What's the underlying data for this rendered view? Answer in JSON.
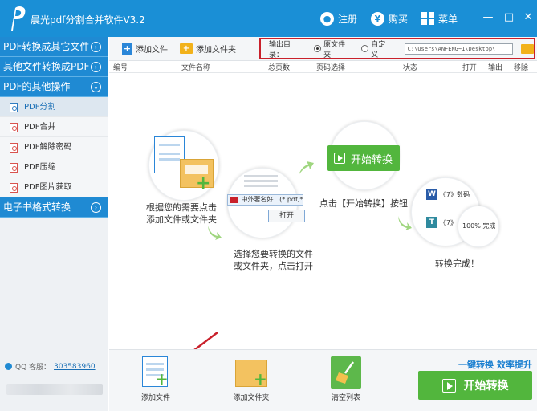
{
  "app": {
    "title": "晨光pdf分割合并软件V3.2",
    "register": "注册",
    "buy": "购买",
    "menu": "菜单",
    "minimize": "—",
    "maximize": "□",
    "close": "✕"
  },
  "sidebar": {
    "sections": [
      {
        "label": "PDF转换成其它文件",
        "chevron": "›"
      },
      {
        "label": "其他文件转换成PDF",
        "chevron": "›"
      },
      {
        "label": "PDF的其他操作",
        "chevron": "⌄"
      }
    ],
    "items": [
      {
        "label": "PDF分割"
      },
      {
        "label": "PDF合并"
      },
      {
        "label": "PDF解除密码"
      },
      {
        "label": "PDF压缩"
      },
      {
        "label": "PDF图片获取"
      }
    ],
    "last_section": {
      "label": "电子书格式转换",
      "chevron": "›"
    },
    "qq_label": "QQ 客服：",
    "qq_number": "303583960"
  },
  "toolbar": {
    "add_file": "添加文件",
    "add_folder": "添加文件夹",
    "output_label": "输出目录：",
    "opt_original": "原文件夹",
    "opt_custom": "自定义",
    "output_path": "C:\\Users\\ANFENG~1\\Desktop\\",
    "selected_option": "原文件夹"
  },
  "columns": [
    "编号",
    "文件名称",
    "总页数",
    "页码选择",
    "状态",
    "打开",
    "输出",
    "移除"
  ],
  "workflow": {
    "step1": "根据您的需要点击\n添加文件或文件夹",
    "step2": "选择您要转换的文件\n或文件夹，点击打开",
    "step3": "点击【开始转换】按钮",
    "step4": "转换完成！",
    "dialog_filename": "中外著名好...(*.pdf,*",
    "dialog_open": "打开",
    "start_mini": "开始转换",
    "done_row1": "《7》数码",
    "done_row2": "《7》",
    "done_progress": "100%",
    "done_status": "完成"
  },
  "bottom": {
    "add_file": "添加文件",
    "add_folder": "添加文件夹",
    "clear_list": "清空列表",
    "slogan": "一键转换 效率提升",
    "start": "开始转换"
  },
  "colors": {
    "title_bar": "#1a8fd6",
    "sidebar_header": "#1f8ad3",
    "start_green": "#52b63d",
    "highlight_red": "#c9202b"
  }
}
